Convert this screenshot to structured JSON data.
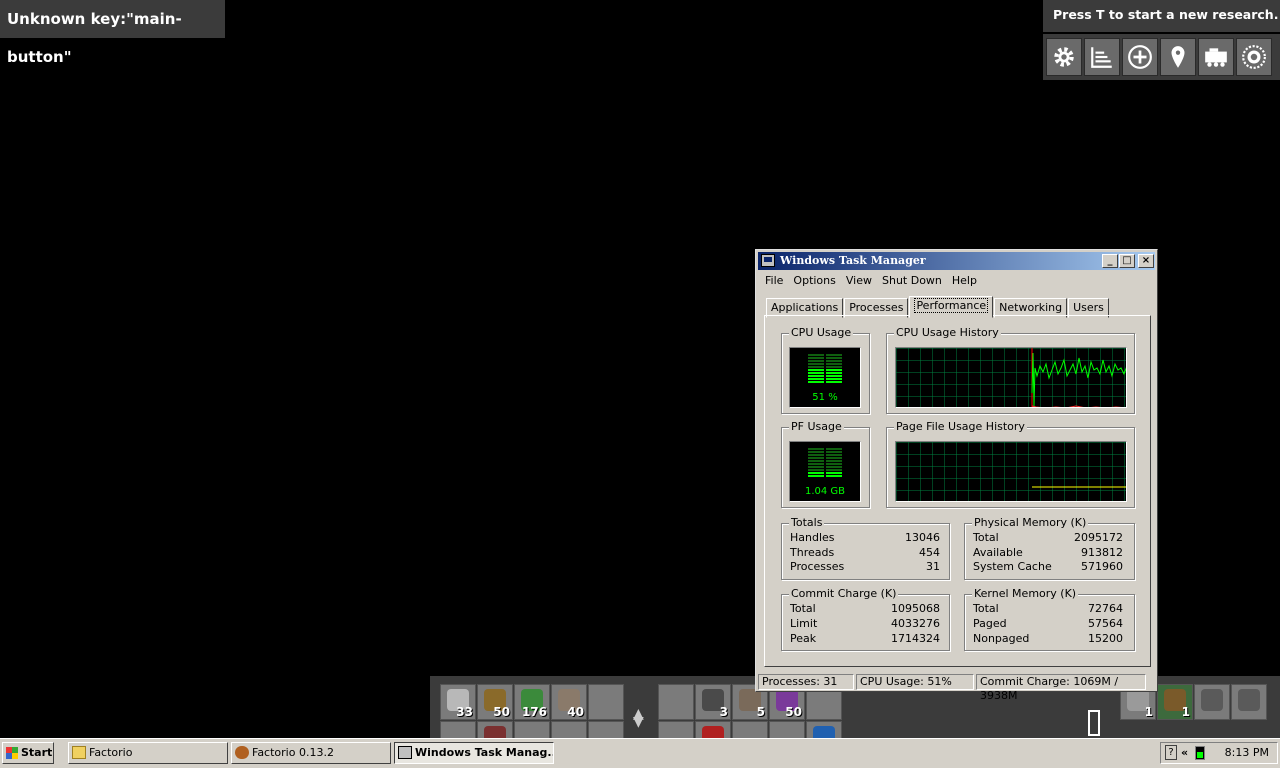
{
  "game": {
    "unknown_key": "Unknown key:\"main-button\"",
    "research_tip": "Press T to start a new research.",
    "toolbar_icons": [
      "gear-icon",
      "production-stats-icon",
      "add-icon",
      "map-pin-icon",
      "train-icon",
      "faction-emblem-icon"
    ],
    "quickbar": {
      "slots": [
        {
          "icon": "iron-chest-icon",
          "count": "33"
        },
        {
          "icon": "transport-belt-icon",
          "count": "50"
        },
        {
          "icon": "green-wire-icon",
          "count": "176"
        },
        {
          "icon": "stone-furnace-icon",
          "count": "40"
        },
        {
          "icon": "empty",
          "count": ""
        },
        {
          "icon": "empty",
          "count": ""
        },
        {
          "icon": "burner-drill-icon",
          "count": "3"
        },
        {
          "icon": "inserter-icon",
          "count": "5"
        },
        {
          "icon": "purple-wire-icon",
          "count": "50"
        },
        {
          "icon": "empty",
          "count": ""
        }
      ],
      "weapon_slots": [
        {
          "icon": "pickaxe-icon",
          "count": "1"
        },
        {
          "icon": "ammo-icon",
          "count": "1"
        },
        {
          "icon": "pistol-icon",
          "count": ""
        },
        {
          "icon": "pistol-icon",
          "count": ""
        }
      ]
    }
  },
  "taskmgr": {
    "title": "Windows Task Manager",
    "menu": [
      "File",
      "Options",
      "View",
      "Shut Down",
      "Help"
    ],
    "tabs": [
      "Applications",
      "Processes",
      "Performance",
      "Networking",
      "Users"
    ],
    "active_tab": "Performance",
    "cpu_usage_label": "CPU Usage",
    "cpu_usage_value": "51 %",
    "cpu_usage_percent": 51,
    "cpu_history_label": "CPU Usage History",
    "pf_usage_label": "PF Usage",
    "pf_usage_value": "1.04 GB",
    "pf_history_label": "Page File Usage History",
    "totals": {
      "label": "Totals",
      "rows": [
        [
          "Handles",
          "13046"
        ],
        [
          "Threads",
          "454"
        ],
        [
          "Processes",
          "31"
        ]
      ]
    },
    "physical": {
      "label": "Physical Memory (K)",
      "rows": [
        [
          "Total",
          "2095172"
        ],
        [
          "Available",
          "913812"
        ],
        [
          "System Cache",
          "571960"
        ]
      ]
    },
    "commit": {
      "label": "Commit Charge (K)",
      "rows": [
        [
          "Total",
          "1095068"
        ],
        [
          "Limit",
          "4033276"
        ],
        [
          "Peak",
          "1714324"
        ]
      ]
    },
    "kernel": {
      "label": "Kernel Memory (K)",
      "rows": [
        [
          "Total",
          "72764"
        ],
        [
          "Paged",
          "57564"
        ],
        [
          "Nonpaged",
          "15200"
        ]
      ]
    },
    "status": {
      "processes": "Processes: 31",
      "cpu": "CPU Usage: 51%",
      "commit": "Commit Charge: 1069M / 3938M"
    }
  },
  "taskbar": {
    "start": "Start",
    "buttons": [
      {
        "label": "Factorio",
        "icon": "folder-icon"
      },
      {
        "label": "Factorio 0.13.2",
        "icon": "factorio-gear-icon"
      },
      {
        "label": "Windows Task Manag...",
        "icon": "taskmgr-icon"
      }
    ],
    "tray_chevron": "«",
    "clock": "8:13 PM"
  }
}
